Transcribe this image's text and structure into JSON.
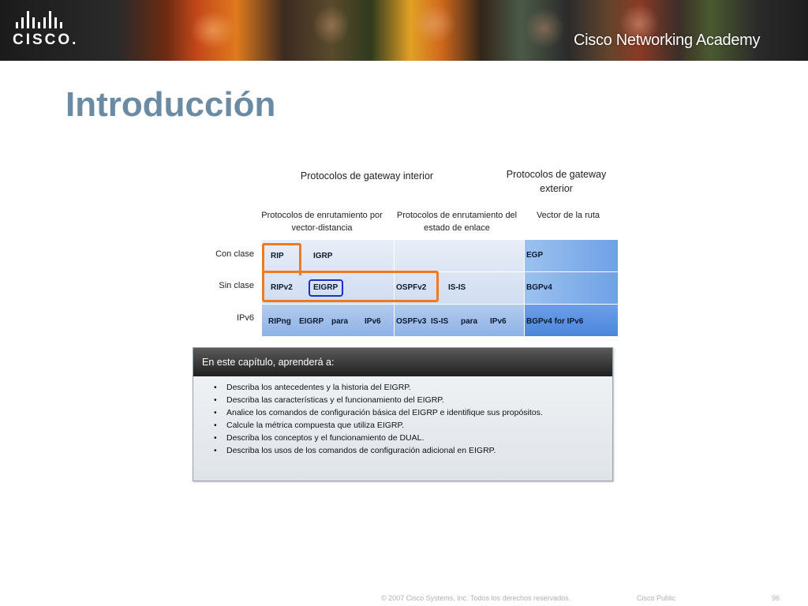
{
  "banner": {
    "logo_text": "CISCO.",
    "brand": "Cisco Networking Academy"
  },
  "slide": {
    "title": "Introducción"
  },
  "figure": {
    "interior_header": "Protocolos de gateway interior",
    "exterior_header_line1": "Protocolos de gateway",
    "exterior_header_line2": "exterior",
    "col1_line1": "Protocolos de enrutamiento por",
    "col1_line2": "vector-distancia",
    "col2_line1": "Protocolos de enrutamiento del",
    "col2_line2": "estado de enlace",
    "col3": "Vector de la ruta",
    "rows": {
      "classful": "Con clase",
      "classless": "Sin clase",
      "ipv6": "IPv6"
    },
    "cells": {
      "rip": "RIP",
      "igrp": "IGRP",
      "egp": "EGP",
      "ripv2": "RIPv2",
      "eigrp": "EIGRP",
      "ospfv2": "OSPFv2",
      "isis": "IS-IS",
      "bgpv4": "BGPv4",
      "ripng": "RIPng",
      "eigrp_ipv6_a": "EIGRP",
      "eigrp_ipv6_b": "para",
      "eigrp_ipv6_c": "IPv6",
      "ospfv3": "OSPFv3",
      "isis_ipv6_a": "IS-IS",
      "isis_ipv6_b": "para",
      "isis_ipv6_c": "IPv6",
      "bgp_ipv6": "BGPv4 for IPv6"
    }
  },
  "objectives": {
    "heading": "En este capítulo, aprenderá a:",
    "items": [
      "Describa los antecedentes y la historia del EIGRP.",
      "Describa las características y el funcionamiento del EIGRP.",
      "Analice los comandos de configuración básica del EIGRP e identifique sus propósitos.",
      "Calcule la métrica compuesta que utiliza EIGRP.",
      "Describa los conceptos y el funcionamiento de DUAL.",
      "Describa los usos de los comandos de configuración adicional en EIGRP."
    ]
  },
  "footer": {
    "copyright": "© 2007 Cisco Systems, Inc. Todos los derechos reservados.",
    "classification": "Cisco Public",
    "page": "96"
  },
  "colors": {
    "title": "#6b8aa3",
    "highlight_orange": "#f07a1e",
    "highlight_blue": "#1c2fc4"
  }
}
